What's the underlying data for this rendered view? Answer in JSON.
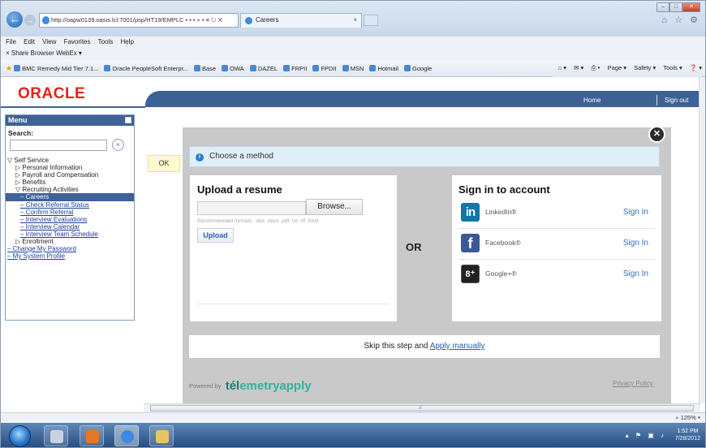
{
  "browser": {
    "address": "http://oapw0139.oasis.lcl:7001/psp/HT19/EMPLC • • •",
    "address_icons": "⌕ • ≡ ↻ ✕",
    "tab_title": "Careers",
    "tab_close": "×",
    "window_buttons": [
      "–",
      "□",
      "✕"
    ],
    "topright_icons": "⌂ ☆ ⚙",
    "menu": [
      "File",
      "Edit",
      "View",
      "Favorites",
      "Tools",
      "Help"
    ],
    "share": "Share Browser",
    "webex": "WebEx ▾",
    "favorites": [
      "BMC Remedy Mid Tier 7.1...",
      "Oracle PeopleSoft Enterpr...",
      "Base",
      "OWA",
      "DAZEL",
      "FRPII",
      "FPDII",
      "MSN",
      "Hotmail",
      "Google"
    ],
    "commands": [
      "⌂ ▾",
      "✉ ▾",
      "⎙ ▾",
      "Page ▾",
      "Safety ▾",
      "Tools ▾",
      "❓ ▾"
    ],
    "zoom": "⌕ 125%  ▾"
  },
  "header": {
    "logo": "ORACLE",
    "nav": {
      "home": "Home",
      "signout": "Sign out"
    }
  },
  "left_menu": {
    "title": "Menu",
    "search_label": "Search:",
    "search_button": "»",
    "items": [
      {
        "label": "▽ Self Service",
        "level": 0
      },
      {
        "label": "▷ Personal Information",
        "level": 1
      },
      {
        "label": "▷ Payroll and Compensation",
        "level": 1
      },
      {
        "label": "▷ Benefits",
        "level": 1
      },
      {
        "label": "▽ Recruiting Activities",
        "level": 1
      },
      {
        "label": "– Careers",
        "level": 2,
        "selected": true
      },
      {
        "label": "– Check Referral Status",
        "level": 2,
        "link": true
      },
      {
        "label": "– Confirm Referral",
        "level": 2,
        "link": true
      },
      {
        "label": "– Interview Evaluations",
        "level": 2,
        "link": true
      },
      {
        "label": "– Interview Calendar",
        "level": 2,
        "link": true
      },
      {
        "label": "– Interview Team Schedule",
        "level": 2,
        "link": true
      },
      {
        "label": "▷ Enrollment",
        "level": 1
      },
      {
        "label": "– Change My Password",
        "level": 0,
        "link": true
      },
      {
        "label": "– My System Profile",
        "level": 0,
        "link": true
      }
    ]
  },
  "ok_label": "OK",
  "modal": {
    "close": "✕",
    "method_icon": "i",
    "method_text": "Choose a method",
    "upload": {
      "title": "Upload a resume",
      "browse": "Browse...",
      "formats": "Recommended formats: .doc .docx .pdf .txt .rtf .html",
      "upload_button": "Upload"
    },
    "or": "OR",
    "signin": {
      "title": "Sign in to account",
      "providers": [
        {
          "logo": "in",
          "name": "LinkedIn®",
          "action": "Sign In"
        },
        {
          "logo": "f",
          "name": "Facebook®",
          "action": "Sign In"
        },
        {
          "logo": "8⁺",
          "name": "Google+®",
          "action": "Sign In"
        }
      ]
    },
    "skip_text": "Skip this step and ",
    "skip_link": "Apply manually",
    "powered_by": "Powered by",
    "brand_prefix": "tél",
    "brand_suffix": "emetryapply",
    "privacy": "Privacy Policy"
  },
  "taskbar": {
    "tray": "▴ ⚑ ▣ ♪",
    "time": "1:52 PM",
    "date": "7/28/2012"
  }
}
